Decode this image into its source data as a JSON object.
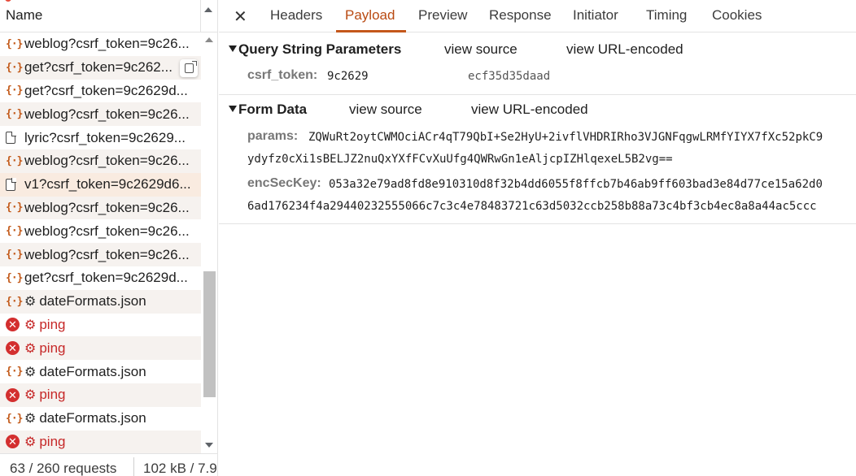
{
  "requests_header": {
    "name_label": "Name"
  },
  "requests": [
    {
      "icon": "fetch-braces-icon",
      "label": "weblog?csrf_token=9c26...",
      "style": "",
      "kind": "normal"
    },
    {
      "icon": "fetch-braces-icon",
      "label": "get?csrf_token=9c262...",
      "style": "alt",
      "kind": "normal",
      "copy_button": true
    },
    {
      "icon": "fetch-braces-icon",
      "label": "get?csrf_token=9c2629d...",
      "style": "",
      "kind": "normal"
    },
    {
      "icon": "fetch-braces-icon",
      "label": "weblog?csrf_token=9c26...",
      "style": "alt",
      "kind": "normal"
    },
    {
      "icon": "document-icon",
      "label": "lyric?csrf_token=9c2629...",
      "style": "",
      "kind": "normal"
    },
    {
      "icon": "fetch-braces-icon",
      "label": "weblog?csrf_token=9c26...",
      "style": "alt",
      "kind": "normal"
    },
    {
      "icon": "document-icon",
      "label": "v1?csrf_token=9c2629d6...",
      "style": "sel",
      "kind": "normal"
    },
    {
      "icon": "fetch-braces-icon",
      "label": "weblog?csrf_token=9c26...",
      "style": "alt",
      "kind": "normal"
    },
    {
      "icon": "fetch-braces-icon",
      "label": "weblog?csrf_token=9c26...",
      "style": "",
      "kind": "normal"
    },
    {
      "icon": "fetch-braces-icon",
      "label": "weblog?csrf_token=9c26...",
      "style": "alt",
      "kind": "normal"
    },
    {
      "icon": "fetch-braces-icon",
      "label": "get?csrf_token=9c2629d...",
      "style": "",
      "kind": "normal"
    },
    {
      "icon": "fetch-braces-icon",
      "label": "dateFormats.json",
      "style": "alt",
      "kind": "gear"
    },
    {
      "icon": "error-icon",
      "label": "ping",
      "style": "",
      "kind": "error"
    },
    {
      "icon": "error-icon",
      "label": "ping",
      "style": "alt",
      "kind": "error"
    },
    {
      "icon": "fetch-braces-icon",
      "label": "dateFormats.json",
      "style": "",
      "kind": "gear"
    },
    {
      "icon": "error-icon",
      "label": "ping",
      "style": "alt",
      "kind": "error"
    },
    {
      "icon": "fetch-braces-icon",
      "label": "dateFormats.json",
      "style": "",
      "kind": "gear"
    },
    {
      "icon": "error-icon",
      "label": "ping",
      "style": "alt",
      "kind": "error"
    }
  ],
  "status": {
    "requests": "63 / 260 requests",
    "transferred": "102 kB / 7.9"
  },
  "tabs": [
    "Headers",
    "Payload",
    "Preview",
    "Response",
    "Initiator",
    "Timing",
    "Cookies"
  ],
  "active_tab": "Payload",
  "query_section": {
    "title": "Query String Parameters",
    "view_source": "view source",
    "view_url_encoded": "view URL-encoded",
    "params": [
      {
        "key": "csrf_token:",
        "value": "9c2629",
        "value_tail": "ecf35d35daad"
      }
    ]
  },
  "form_section": {
    "title": "Form Data",
    "view_source": "view source",
    "view_url_encoded": "view URL-encoded",
    "params": [
      {
        "key": "params:",
        "line1": "ZQWuRt2oytCWMOciACr4qT79QbI+Se2HyU+2ivflVHDRIRho3VJGNFqgwLRMfYIYX7fXc52pkC9",
        "line2": "ydyfz0cXi1sBELJZ2nuQxYXfFCvXuUfg4QWRwGn1eAljcpIZHlqexeL5B2vg=="
      },
      {
        "key": "encSecKey:",
        "line1": "053a32e79ad8fd8e910310d8f32b4dd6055f8ffcb7b46ab9ff603bad3e84d77ce15a62d0",
        "line2": "6ad176234f4a29440232555066c7c3c4e78483721c63d5032ccb258b88a73c4bf3cb4ec8a8a44ac5ccc"
      }
    ]
  }
}
